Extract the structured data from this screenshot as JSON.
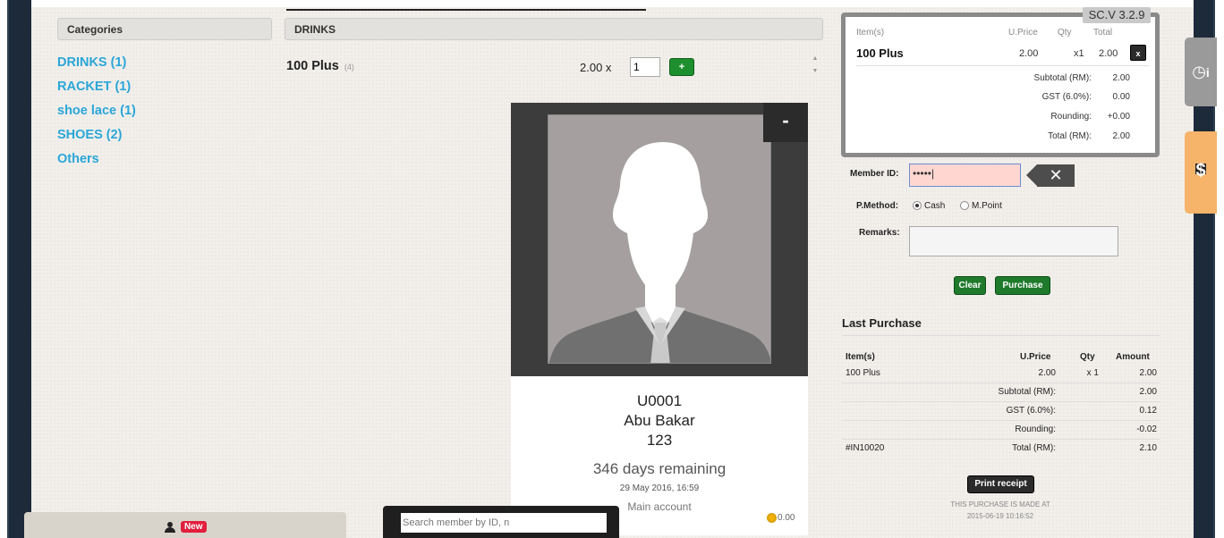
{
  "categories": {
    "header": "Categories",
    "items": [
      {
        "label": "DRINKS (1)"
      },
      {
        "label": "RACKET (1)"
      },
      {
        "label": "shoe lace (1)"
      },
      {
        "label": "SHOES (2)"
      },
      {
        "label": "Others"
      }
    ]
  },
  "products": {
    "header": "DRINKS",
    "items": [
      {
        "name": "100 Plus",
        "stock": "(4)",
        "price_prefix": "2.00 x",
        "qty": "1",
        "add_label": "+"
      }
    ]
  },
  "member_popup": {
    "minimize_label": "-",
    "member_id": "U0001",
    "name": "Abu Bakar",
    "code": "123",
    "days_remaining": "346 days remaining",
    "expiry": "29 May 2016, 16:59",
    "account_type": "Main account",
    "points": "0.00"
  },
  "cart": {
    "version": "SC.V 3.2.9",
    "headers": {
      "item": "Item(s)",
      "uprice": "U.Price",
      "qty": "Qty",
      "total": "Total"
    },
    "item": {
      "name": "100 Plus",
      "uprice": "2.00",
      "qty": "x1",
      "total": "2.00",
      "remove_label": "x"
    },
    "summary": [
      {
        "label": "Subtotal (RM):",
        "value": "2.00"
      },
      {
        "label": "GST (6.0%):",
        "value": "0.00"
      },
      {
        "label": "Rounding:",
        "value": "+0.00"
      },
      {
        "label": "Total (RM):",
        "value": "2.00"
      }
    ]
  },
  "form": {
    "member_id_label": "Member ID:",
    "member_id_value": "•••••|",
    "clear_input_icon": "close-icon",
    "payment_label": "P.Method:",
    "payment_options": [
      {
        "label": "Cash",
        "selected": true
      },
      {
        "label": "M.Point",
        "selected": false
      }
    ],
    "remarks_label": "Remarks:",
    "clear_button": "Clear",
    "purchase_button": "Purchase"
  },
  "last_purchase": {
    "title": "Last Purchase",
    "headers": {
      "item": "Item(s)",
      "uprice": "U.Price",
      "qty": "Qty",
      "amount": "Amount"
    },
    "rows": [
      {
        "item": "100 Plus",
        "uprice": "2.00",
        "qty": "x 1",
        "amount": "2.00"
      }
    ],
    "summary": [
      {
        "label": "Subtotal (RM):",
        "value": "2.00"
      },
      {
        "label": "GST (6.0%):",
        "value": "0.12"
      },
      {
        "label": "Rounding:",
        "value": "-0.02"
      },
      {
        "label": "Total (RM):",
        "value": "2.10"
      }
    ],
    "invoice": "#IN10020",
    "print_button": "Print receipt",
    "made_at_label": "THIS PURCHASE IS MADE AT",
    "made_at_time": "2015-06-19 10:16:52"
  },
  "bottom": {
    "new_badge": "New",
    "search_placeholder": "Search member by ID, n"
  },
  "colors": {
    "link": "#2aa6d8",
    "add_green": "#1e8f2e",
    "badge_red": "#e21f3d",
    "side_tab_orange": "#f6b36a"
  }
}
